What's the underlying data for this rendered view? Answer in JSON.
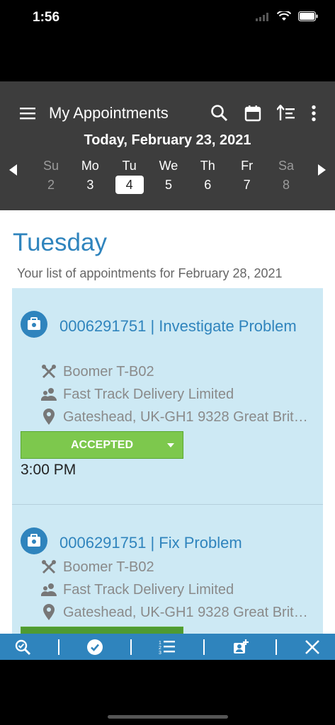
{
  "status_bar": {
    "time": "1:56"
  },
  "app_bar": {
    "title": "My Appointments",
    "today_label": "Today, February 23, 2021"
  },
  "week": [
    {
      "name": "Su",
      "num": "2",
      "muted": true,
      "selected": false
    },
    {
      "name": "Mo",
      "num": "3",
      "muted": false,
      "selected": false
    },
    {
      "name": "Tu",
      "num": "4",
      "muted": false,
      "selected": true
    },
    {
      "name": "We",
      "num": "5",
      "muted": false,
      "selected": false
    },
    {
      "name": "Th",
      "num": "6",
      "muted": false,
      "selected": false
    },
    {
      "name": "Fr",
      "num": "7",
      "muted": false,
      "selected": false
    },
    {
      "name": "Sa",
      "num": "8",
      "muted": true,
      "selected": false
    }
  ],
  "main": {
    "heading": "Tuesday",
    "subheading": "Your list of appointments for February 28, 2021"
  },
  "appointments": [
    {
      "title": "0006291751 | Investigate Problem",
      "equipment": "Boomer T-B02",
      "customer": "Fast Track Delivery Limited",
      "address": "Gateshead, UK-GH1 9328 Great Brit…",
      "status": "ACCEPTED",
      "time": "3:00 PM"
    },
    {
      "title": "0006291751 | Fix Problem",
      "equipment": "Boomer T-B02",
      "customer": "Fast Track Delivery Limited",
      "address": "Gateshead, UK-GH1 9328 Great Brit…",
      "status": "",
      "time": ""
    }
  ],
  "colors": {
    "accent": "#2f84bd",
    "app_bar": "#3d3d3d",
    "list_bg": "#cde9f4",
    "accepted": "#7dc84d"
  },
  "bottom_bar_icons": [
    "search-check-icon",
    "check-circle-icon",
    "numbered-list-icon",
    "add-contact-icon",
    "close-icon"
  ]
}
